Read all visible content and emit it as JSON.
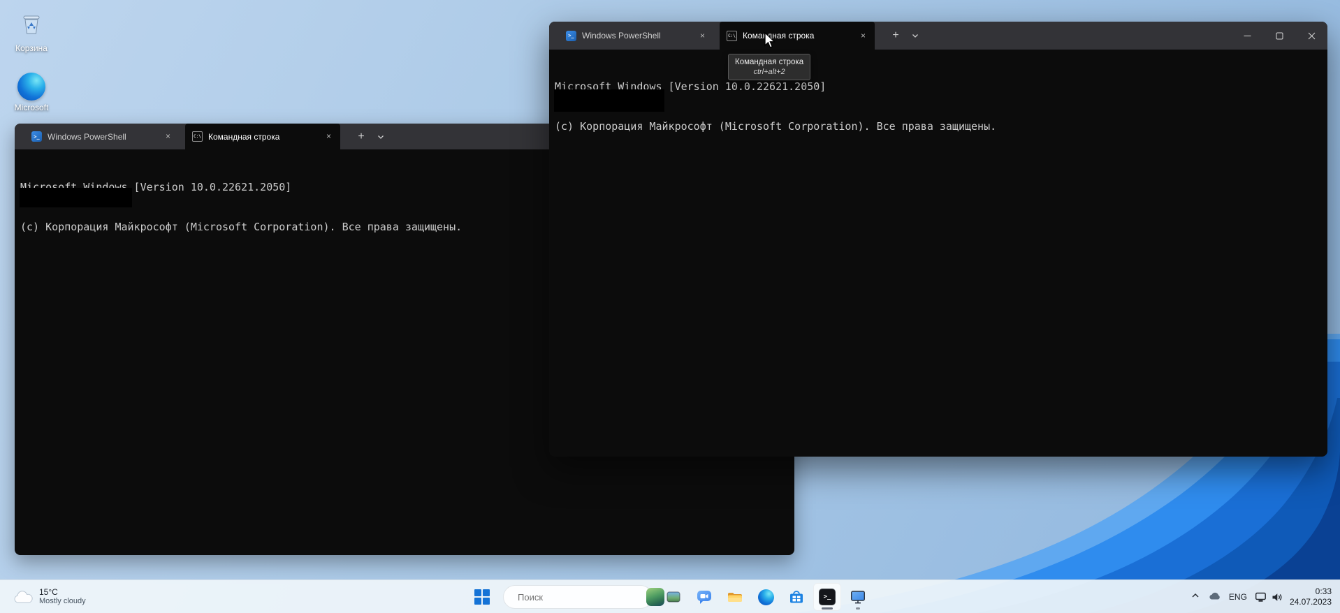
{
  "colors": {
    "terminal_background": "#0c0c0c",
    "terminal_tab_bar": "#333337",
    "terminal_text": "#cccccc",
    "taskbar_background": "#eff5fa",
    "wallpaper_light": "#bdd5ee",
    "wallpaper_dark": "#8fb6de",
    "bloom_blue": "#1a6fd6"
  },
  "icons": {
    "close_glyph": "×",
    "plus_glyph": "+",
    "powershell_glyph": ">_",
    "cmd_glyph": "C:\\",
    "terminal_glyph": ">_"
  },
  "desktop": {
    "icons": [
      {
        "name": "recycle-bin",
        "label": "Корзина"
      },
      {
        "name": "microsoft-edge",
        "label": "Microsoft"
      }
    ]
  },
  "window_back": {
    "tabs": [
      {
        "label": "Windows PowerShell",
        "active": false
      },
      {
        "label": "Командная строка",
        "active": true
      }
    ],
    "lines": [
      "Microsoft Windows [Version 10.0.22621.2050]",
      "(c) Корпорация Майкрософт (Microsoft Corporation). Все права защищены."
    ]
  },
  "window_front": {
    "tabs": [
      {
        "label": "Windows PowerShell",
        "active": false
      },
      {
        "label": "Командная строка",
        "active": true
      }
    ],
    "lines": [
      "Microsoft Windows [Version 10.0.22621.2050]",
      "(c) Корпорация Майкрософт (Microsoft Corporation). Все права защищены."
    ],
    "tooltip": {
      "title": "Командная строка",
      "shortcut": "ctrl+alt+2"
    }
  },
  "taskbar": {
    "weather": {
      "temperature": "15°C",
      "condition": "Mostly cloudy"
    },
    "search_placeholder": "Поиск",
    "tray": {
      "language": "ENG",
      "time": "0:33",
      "date": "24.07.2023"
    }
  }
}
